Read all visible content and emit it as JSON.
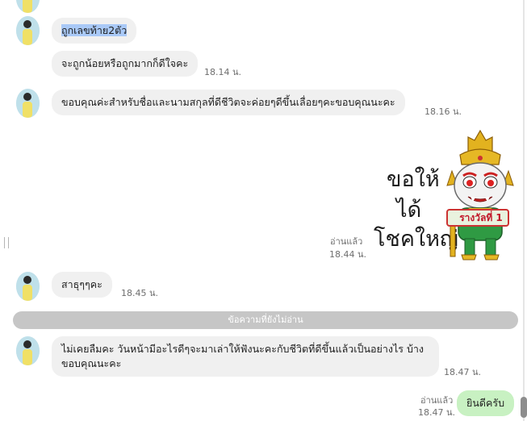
{
  "messages": {
    "m1_text": "ถูกเลขท้าย2ตัว",
    "m2_text": "จะถูกน้อยหรือถูกมากก็ดีใจคะ",
    "m2_time": "18.14 น.",
    "m3_text": "ขอบคุณค่ะสำหรับชื่อและนามสกุลที่ดีชีวิตจะค่อยๆดีขึ้นเลื่อยๆคะขอบคุณนะคะ",
    "m3_time": "18.16 น.",
    "sticker": {
      "line1": "ขอให้",
      "line2": "ได้",
      "line3": "โชคใหญ่",
      "badge": "รางวัลที่ 1",
      "read": "อ่านแล้ว",
      "time": "18.44 น."
    },
    "m5_text": "สาธุๆๆคะ",
    "m5_time": "18.45 น.",
    "unread_divider": "ข้อความที่ยังไม่อ่าน",
    "m6_text": "ไม่เคยลืมคะ วันหน้ามีอะไรดีๆจะมาเล่าให้ฟังนะคะกับชีวิตที่ดีขึ้นแล้วเป็นอย่างไร บ้าง ขอบคุณนะคะ",
    "m6_time": "18.47 น.",
    "m7_text": "ยินดีครับ",
    "m7_read": "อ่านแล้ว",
    "m7_time": "18.47 น."
  },
  "colors": {
    "incoming_bubble": "#f0f0f0",
    "outgoing_bubble": "#c8f1c2",
    "selection": "#a9c9f7",
    "divider": "#c6c6c6"
  },
  "icons": {
    "avatar": "user-avatar-photo",
    "resize_handle": "vertical-drag-handle-icon"
  }
}
